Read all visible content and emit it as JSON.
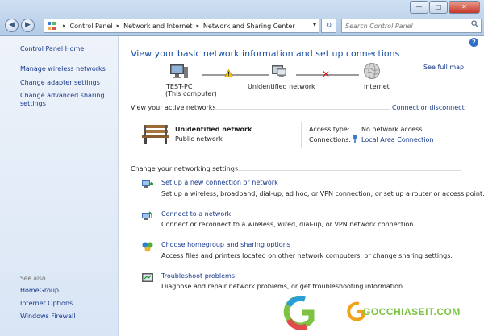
{
  "window": {
    "minimize_glyph": "—",
    "maximize_glyph": "□",
    "close_glyph": "✕"
  },
  "nav": {
    "back_glyph": "◀",
    "forward_glyph": "▶",
    "breadcrumbs": [
      "Control Panel",
      "Network and Internet",
      "Network and Sharing Center"
    ],
    "separator": "▸",
    "dropdown_glyph": "▾",
    "refresh_glyph": "↻",
    "search_placeholder": "Search Control Panel",
    "search_icon": "search-icon",
    "help_glyph": "?"
  },
  "sidebar": {
    "home": "Control Panel Home",
    "items": [
      "Manage wireless networks",
      "Change adapter settings",
      "Change advanced sharing",
      "settings"
    ],
    "see_also_title": "See also",
    "see_also": [
      "HomeGroup",
      "Internet Options",
      "Windows Firewall"
    ]
  },
  "main": {
    "heading": "View your basic network information and set up connections",
    "see_full_map": "See full map",
    "map": {
      "pc_name": "TEST-PC",
      "pc_sub": "(This computer)",
      "middle": "Unidentified network",
      "internet": "Internet"
    },
    "active_networks_title": "View your active networks",
    "connect_disconnect": "Connect or disconnect",
    "active_network": {
      "name": "Unidentified network",
      "type": "Public network",
      "access_type_label": "Access type:",
      "access_type_value": "No network access",
      "connections_label": "Connections:",
      "connections_value": "Local Area Connection"
    },
    "change_settings_title": "Change your networking settings",
    "tasks": [
      {
        "title": "Set up a new connection or network",
        "desc": "Set up a wireless, broadband, dial-up, ad hoc, or VPN connection; or set up a router or access point."
      },
      {
        "title": "Connect to a network",
        "desc": "Connect or reconnect to a wireless, wired, dial-up, or VPN network connection."
      },
      {
        "title": "Choose homegroup and sharing options",
        "desc": "Access files and printers located on other network computers, or change sharing settings."
      },
      {
        "title": "Troubleshoot problems",
        "desc": "Diagnose and repair network problems, or get troubleshooting information."
      }
    ]
  },
  "watermark": {
    "text": "GOCCHIASEIT.COM",
    "colors": [
      "#2a9fd6",
      "#f0a21a",
      "#7ec242",
      "#e24b4b"
    ]
  }
}
